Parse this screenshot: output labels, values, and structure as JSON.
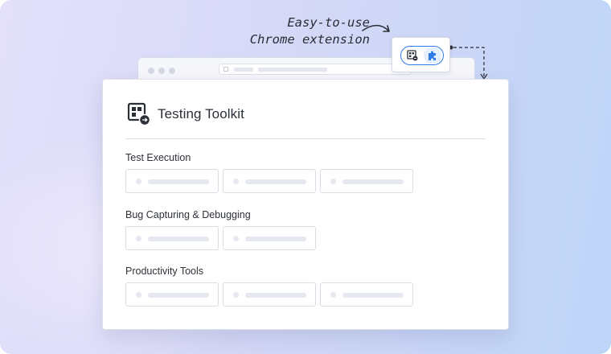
{
  "callout": {
    "line1": "Easy-to-use",
    "line2": "Chrome extension"
  },
  "colors": {
    "accent": "#2f7ce8",
    "text": "#2b2f38",
    "placeholder": "#e5e8ee",
    "border": "#d9dde5"
  },
  "icons": {
    "extension_toolkit": "testing-toolkit-icon",
    "extension_puzzle": "puzzle-piece-icon",
    "card_logo": "testing-toolkit-logo-icon"
  },
  "card": {
    "title": "Testing Toolkit",
    "sections": [
      {
        "label": "Test Execution",
        "tile_count": 3
      },
      {
        "label": "Bug Capturing & Debugging",
        "tile_count": 2
      },
      {
        "label": "Productivity Tools",
        "tile_count": 3
      }
    ]
  }
}
